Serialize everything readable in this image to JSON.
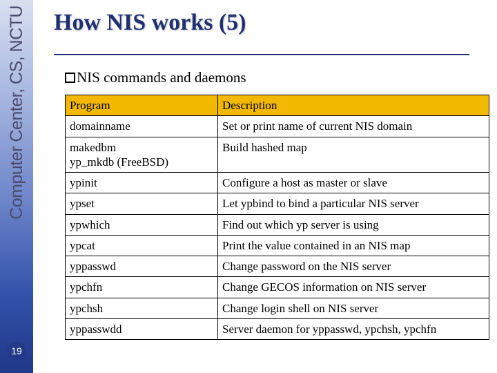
{
  "sidebar_text": "Computer Center, CS, NCTU",
  "page_number": "19",
  "title": "How NIS works (5)",
  "subtitle": "NIS commands and daemons",
  "table": {
    "headers": {
      "program": "Program",
      "description": "Description"
    },
    "rows": [
      {
        "program": "domainname",
        "description": "Set or print name of current NIS domain"
      },
      {
        "program": "makedbm\nyp_mkdb (FreeBSD)",
        "description": "Build hashed map"
      },
      {
        "program": "ypinit",
        "description": "Configure a host as master or slave"
      },
      {
        "program": "ypset",
        "description": "Let ypbind to bind a particular NIS server"
      },
      {
        "program": "ypwhich",
        "description": "Find out which yp server is using"
      },
      {
        "program": "ypcat",
        "description": "Print the value contained in an NIS map"
      },
      {
        "program": "yppasswd",
        "description": "Change password on the NIS server"
      },
      {
        "program": "ypchfn",
        "description": "Change GECOS information on NIS server"
      },
      {
        "program": "ypchsh",
        "description": "Change login shell on NIS server"
      },
      {
        "program": "yppasswdd",
        "description": "Server daemon for yppasswd, ypchsh, ypchfn"
      }
    ]
  }
}
